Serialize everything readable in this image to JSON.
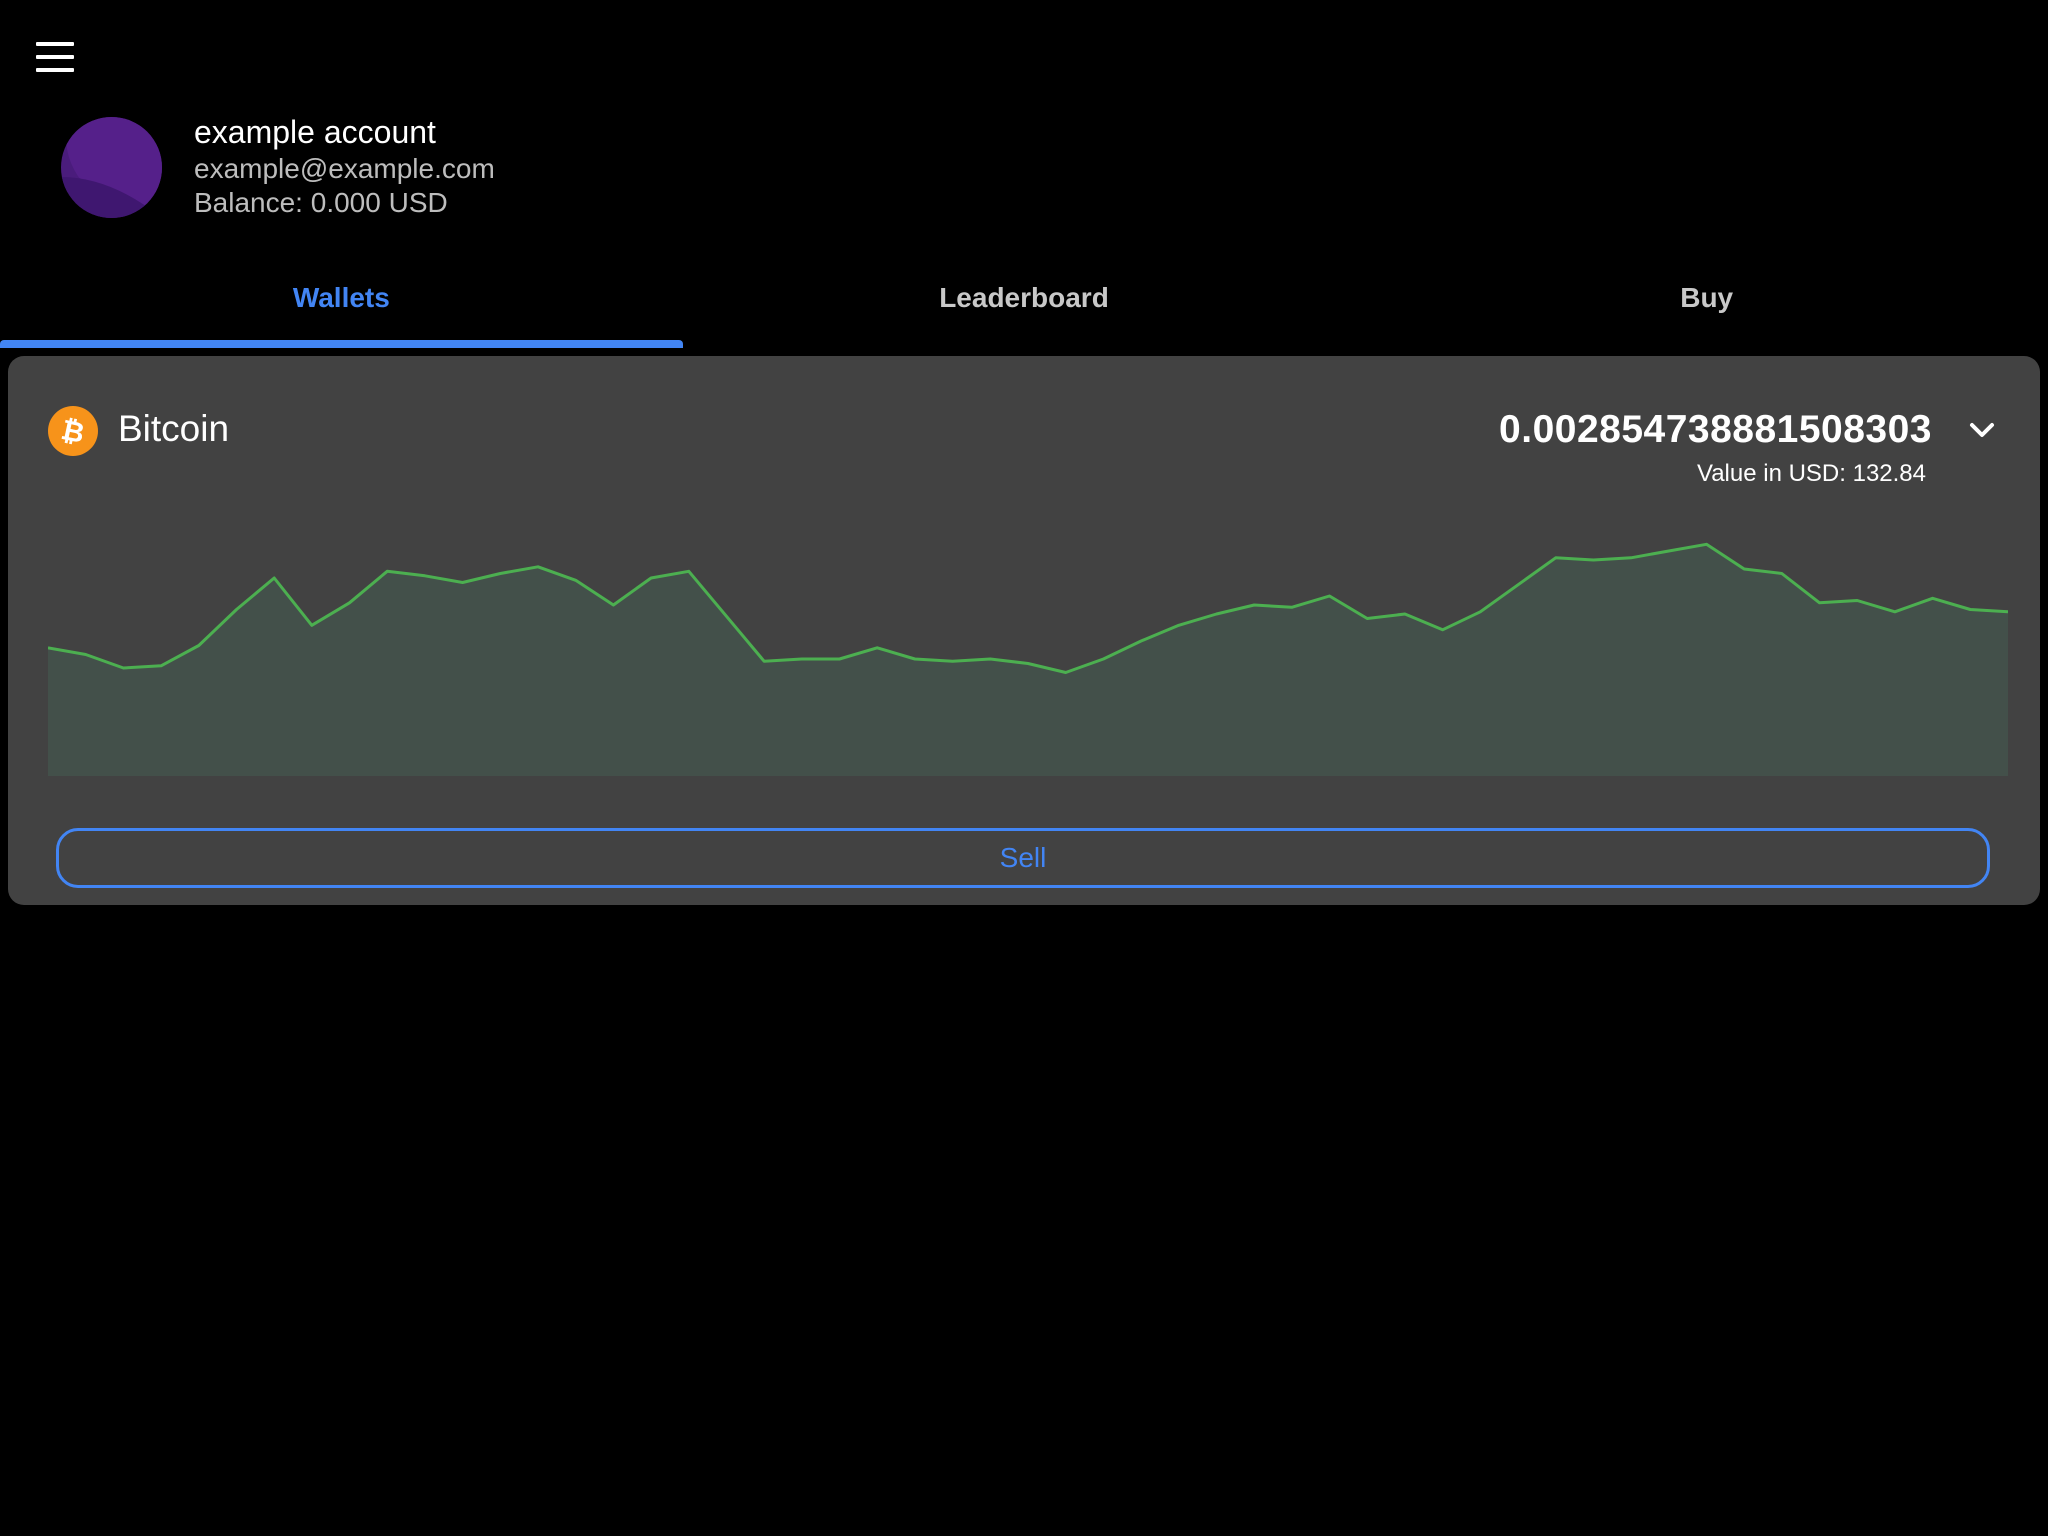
{
  "account": {
    "name": "example account",
    "email": "example@example.com",
    "balance": "Balance: 0.000 USD"
  },
  "tabs": [
    {
      "label": "Wallets",
      "active": true
    },
    {
      "label": "Leaderboard",
      "active": false
    },
    {
      "label": "Buy",
      "active": false
    }
  ],
  "wallet": {
    "coin_name": "Bitcoin",
    "amount": "0.002854738881508303",
    "value_usd": "Value in USD: 132.84",
    "sell_label": "Sell"
  },
  "colors": {
    "accent": "#4285f4",
    "chart_line": "#4caf50",
    "chart_fill": "#43504a",
    "bitcoin": "#f7931a",
    "card": "#424242",
    "avatar": "#4a1a7a"
  },
  "icons": {
    "menu": "hamburger-menu-icon",
    "coin": "bitcoin-icon",
    "expand": "chevron-down-icon"
  },
  "chart_data": {
    "type": "area",
    "series": [
      {
        "values": [
          57,
          54,
          48,
          49,
          58,
          74,
          88,
          67,
          77,
          91,
          89,
          86,
          90,
          93,
          87,
          76,
          88,
          91,
          71,
          51,
          52,
          52,
          57,
          52,
          51,
          52,
          50,
          46,
          52,
          60,
          67,
          72,
          76,
          75,
          80,
          70,
          72,
          65,
          73,
          85,
          97,
          96,
          97,
          100,
          103,
          92,
          90,
          77,
          78,
          73,
          79,
          74,
          73
        ]
      }
    ]
  }
}
